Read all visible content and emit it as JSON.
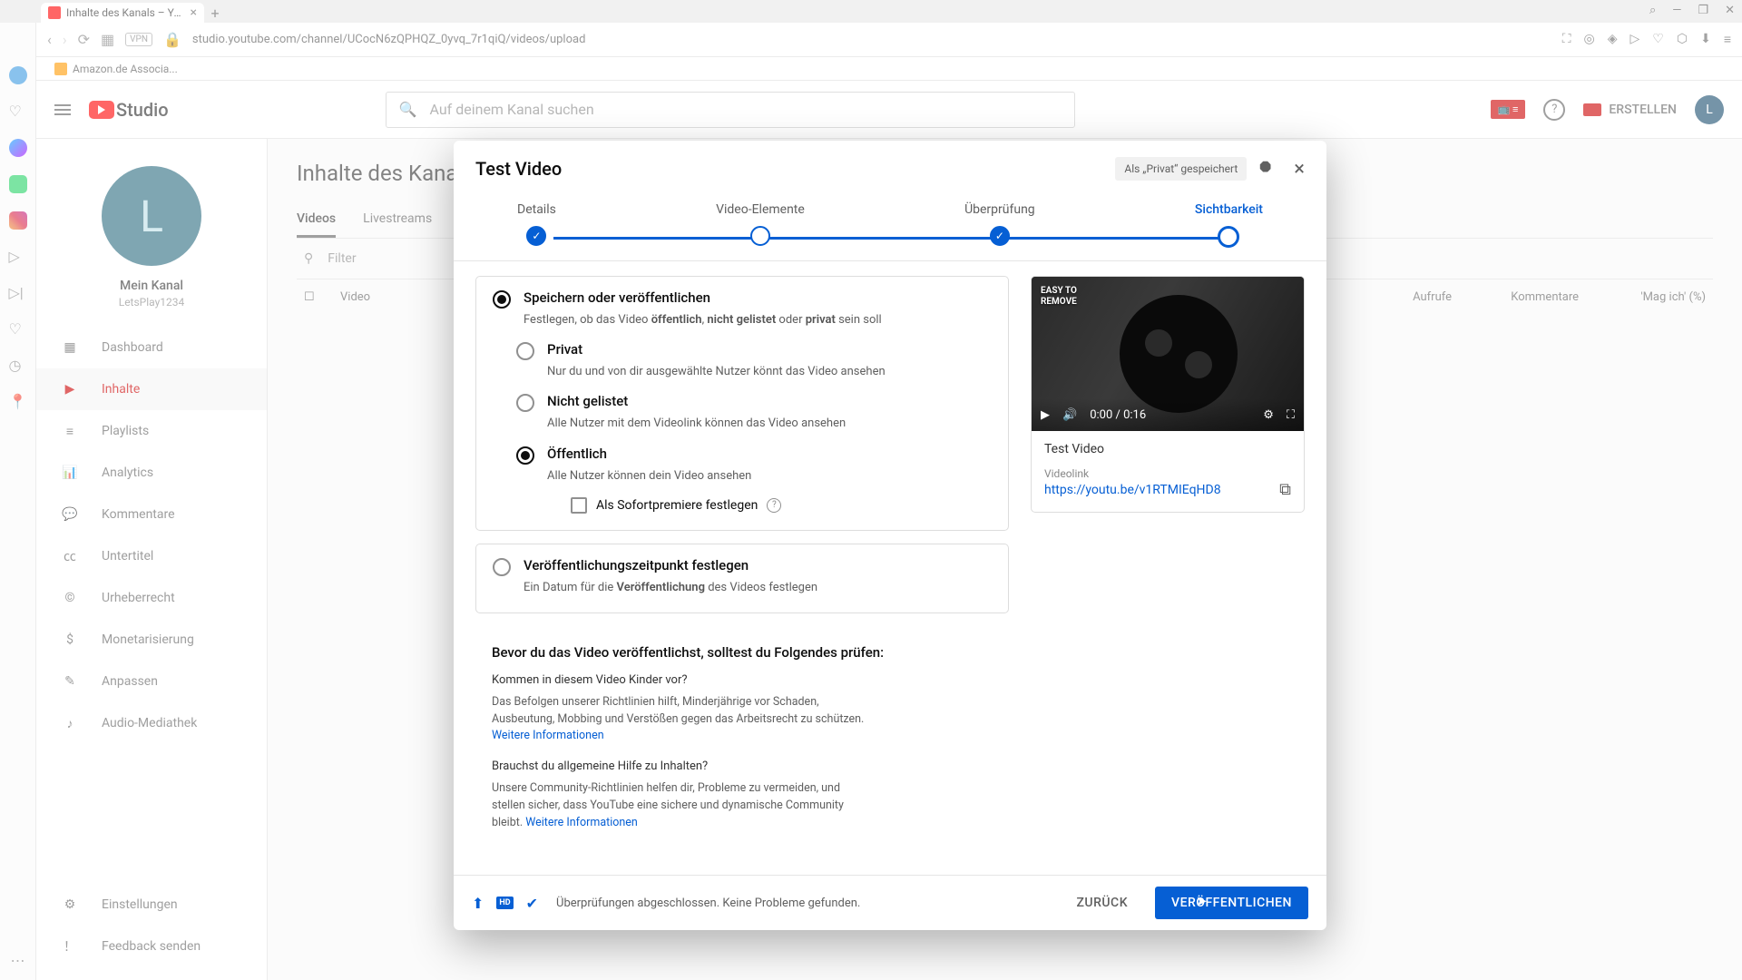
{
  "browser": {
    "tab_title": "Inhalte des Kanals – YouT",
    "url": "studio.youtube.com/channel/UCocN6zQPHQZ_0yvq_7r1qiQ/videos/upload",
    "bookmark": "Amazon.de Associa...",
    "vpn": "VPN",
    "search_glyph": "⌕"
  },
  "header": {
    "logo": "Studio",
    "search_placeholder": "Auf deinem Kanal suchen",
    "create": "ERSTELLEN",
    "avatar": "L"
  },
  "channel": {
    "initial": "L",
    "name": "Mein Kanal",
    "handle": "LetsPlay1234"
  },
  "sidebar": {
    "items": [
      {
        "label": "Dashboard"
      },
      {
        "label": "Inhalte"
      },
      {
        "label": "Playlists"
      },
      {
        "label": "Analytics"
      },
      {
        "label": "Kommentare"
      },
      {
        "label": "Untertitel"
      },
      {
        "label": "Urheberrecht"
      },
      {
        "label": "Monetarisierung"
      },
      {
        "label": "Anpassen"
      },
      {
        "label": "Audio-Mediathek"
      }
    ],
    "bottom": [
      {
        "label": "Einstellungen"
      },
      {
        "label": "Feedback senden"
      }
    ]
  },
  "main": {
    "title": "Inhalte des Kana",
    "tabs": [
      {
        "label": "Videos"
      },
      {
        "label": "Livestreams"
      }
    ],
    "filter": "Filter",
    "columns": {
      "video": "Video",
      "views": "Aufrufe",
      "comments": "Kommentare",
      "likes": "'Mag ich' (%)"
    }
  },
  "dialog": {
    "title": "Test Video",
    "saved": "Als „Privat“ gespeichert",
    "steps": [
      {
        "label": "Details"
      },
      {
        "label": "Video-Elemente"
      },
      {
        "label": "Überprüfung"
      },
      {
        "label": "Sichtbarkeit"
      }
    ],
    "save_publish": {
      "title": "Speichern oder veröffentlichen",
      "desc_pre": "Festlegen, ob das Video ",
      "desc_b1": "öffentlich",
      "desc_sep1": ", ",
      "desc_b2": "nicht gelistet",
      "desc_sep2": " oder ",
      "desc_b3": "privat",
      "desc_post": " sein soll"
    },
    "privacy": {
      "private": {
        "label": "Privat",
        "desc": "Nur du und von dir ausgewählte Nutzer könnt das Video ansehen"
      },
      "unlisted": {
        "label": "Nicht gelistet",
        "desc": "Alle Nutzer mit dem Videolink können das Video ansehen"
      },
      "public": {
        "label": "Öffentlich",
        "desc": "Alle Nutzer können dein Video ansehen"
      }
    },
    "premiere": "Als Sofortpremiere festlegen",
    "schedule": {
      "title": "Veröffentlichungszeitpunkt festlegen",
      "desc_pre": "Ein Datum für die ",
      "desc_b": "Veröffentlichung",
      "desc_post": " des Videos festlegen"
    },
    "checks": {
      "heading": "Bevor du das Video veröffentlichst, solltest du Folgendes prüfen:",
      "q1": "Kommen in diesem Video Kinder vor?",
      "a1": "Das Befolgen unserer Richtlinien hilft, Minderjährige vor Schaden, Ausbeutung, Mobbing und Verstößen gegen das Arbeitsrecht zu schützen. ",
      "link1": "Weitere Informationen",
      "q2": "Brauchst du allgemeine Hilfe zu Inhalten?",
      "a2": "Unsere Community-Richtlinien helfen dir, Probleme zu vermeiden, und stellen sicher, dass YouTube eine sichere und dynamische Community bleibt. ",
      "link2": "Weitere Informationen"
    },
    "preview": {
      "thumb_text": "EASY TO\nREMOVE",
      "time": "0:00 / 0:16",
      "title": "Test Video",
      "link_label": "Videolink",
      "link": "https://youtu.be/v1RTMIEqHD8"
    },
    "footer": {
      "status": "Überprüfungen abgeschlossen. Keine Probleme gefunden.",
      "back": "ZURÜCK",
      "publish": "VERÖFFENTLICHEN"
    }
  }
}
